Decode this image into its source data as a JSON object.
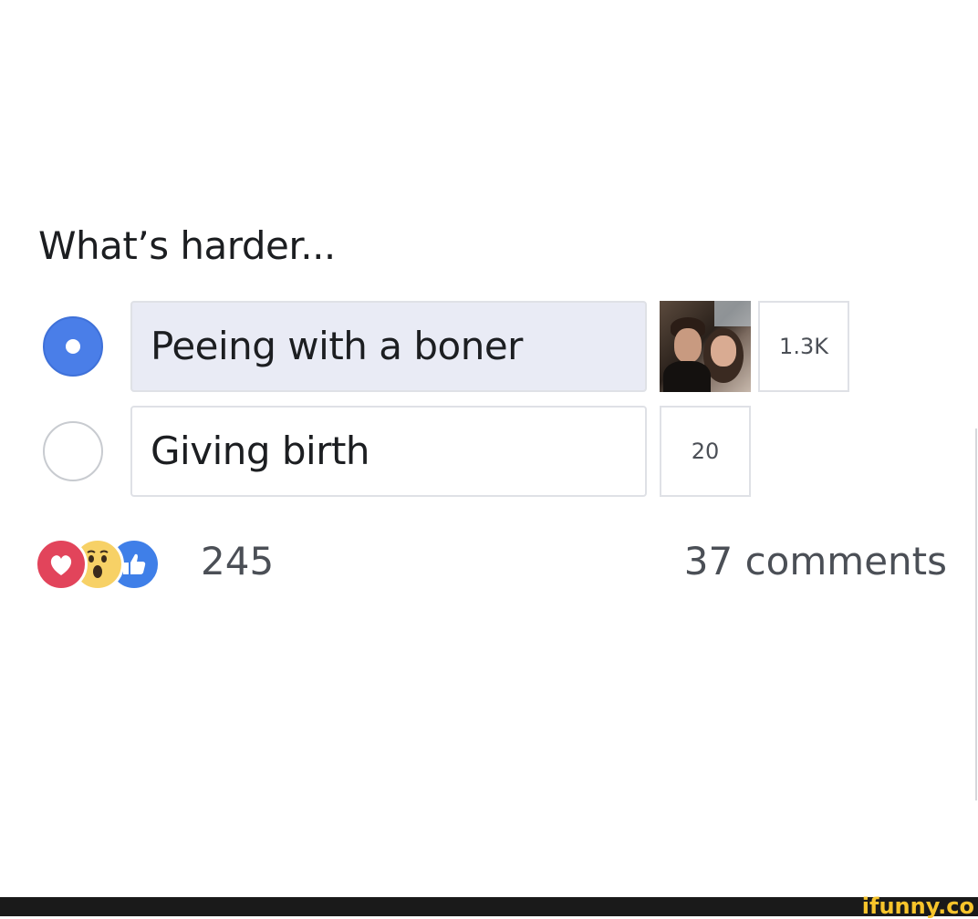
{
  "poll": {
    "question": "What’s harder...",
    "options": [
      {
        "label": "Peeing with a boner",
        "votes": "1.3K",
        "selected": true,
        "has_voter_avatar": true
      },
      {
        "label": "Giving birth",
        "votes": "20",
        "selected": false,
        "has_voter_avatar": false
      }
    ]
  },
  "footer": {
    "reactions": [
      "love-icon",
      "wow-icon",
      "like-icon"
    ],
    "reaction_count": "245",
    "comments": "37 comments"
  },
  "watermark": "ifunny.co",
  "colors": {
    "selected_radio": "#4a7ee8",
    "love": "#e2445b",
    "wow": "#f7d166",
    "like": "#3f7fe8",
    "watermark": "#f7c42b"
  }
}
